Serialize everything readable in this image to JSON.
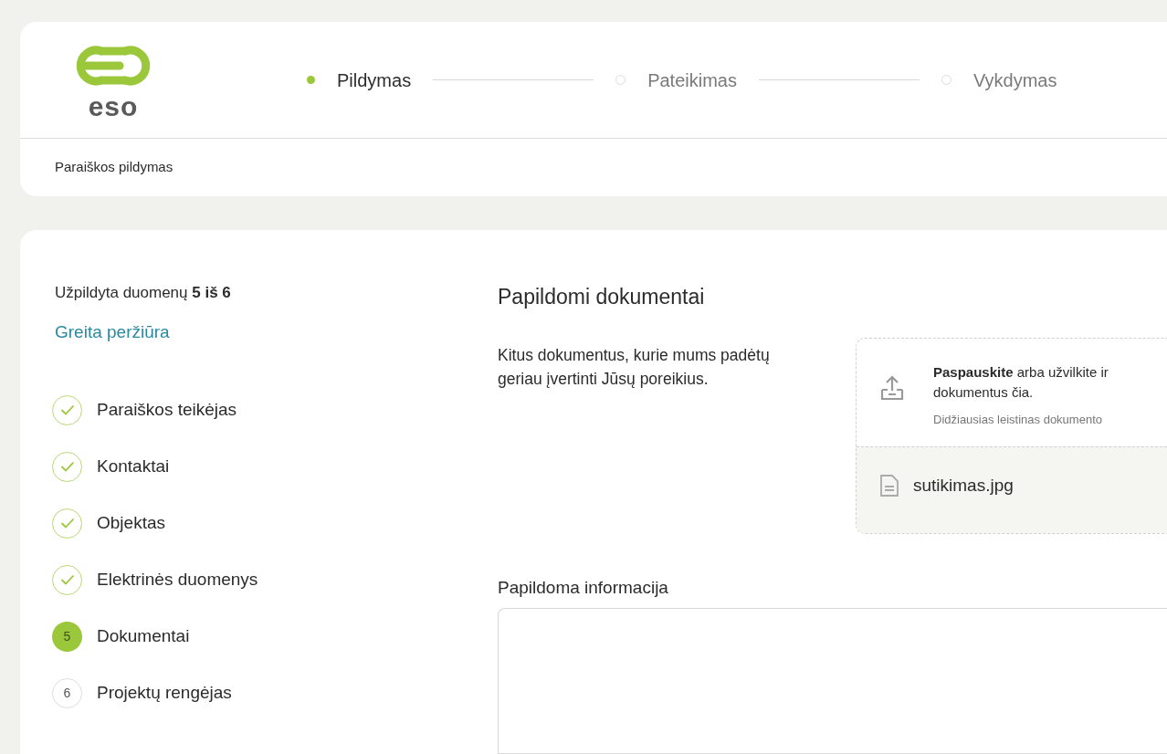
{
  "header": {
    "logo_text": "eso",
    "steps": [
      {
        "label": "Pildymas",
        "selected": true
      },
      {
        "label": "Pateikimas",
        "selected": false
      },
      {
        "label": "Vykdymas",
        "selected": false
      }
    ],
    "breadcrumb": "Paraiškos pildymas"
  },
  "sidebar": {
    "progress": "Užpildyta duomenų **5 iš 6**",
    "quick_view": "Greita peržiūra",
    "items": [
      {
        "label": "Paraiškos teikėjas",
        "kind": "done"
      },
      {
        "label": "Kontaktai",
        "kind": "done"
      },
      {
        "label": "Objektas",
        "kind": "done"
      },
      {
        "label": "Elektrinės duomenys",
        "kind": "done"
      },
      {
        "label": "Dokumentai",
        "kind": "current",
        "number": "5"
      },
      {
        "label": "Projektų rengėjas",
        "kind": "pending",
        "number": "6"
      }
    ]
  },
  "section": {
    "title": "Papildomi dokumentai",
    "description": "Kitus dokumentus, kurie mums padėtų geriau įvertinti Jūsų poreikius.",
    "upload": {
      "prompt": "**Paspauskite** arba užvilkite ir",
      "prompt_line2": "dokumentus čia.",
      "hint": "Didžiausias leistinas dokumento"
    },
    "files": [
      {
        "name": "sutikimas.jpg"
      }
    ],
    "notes_label": "Papildoma informacija"
  }
}
